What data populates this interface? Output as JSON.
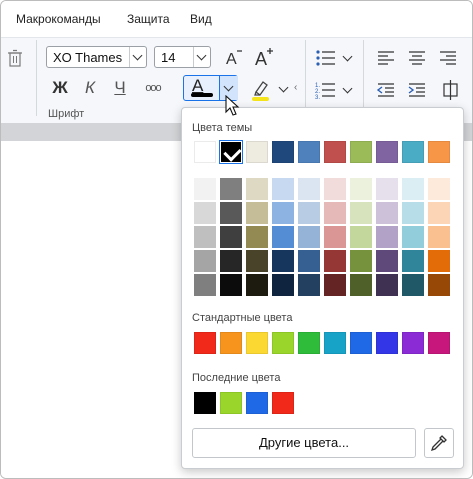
{
  "menubar": {
    "items": [
      "Макрокоманды",
      "Защита",
      "Вид"
    ]
  },
  "ribbon": {
    "font_name": "XO Thames",
    "font_size": "14",
    "font_group_label": "Шрифт",
    "bold_glyph": "Ж",
    "italic_glyph": "К",
    "underline_glyph": "Ч",
    "more_glyph": "ооо",
    "text_color_glyph": "А"
  },
  "color_panel": {
    "theme_title": "Цвета темы",
    "standard_title": "Стандартные цвета",
    "recent_title": "Последние цвета",
    "more_colors_label": "Другие цвета...",
    "selected_color": "#000000",
    "theme_colors": [
      "#ffffff",
      "#000000",
      "#eeece1",
      "#1f497d",
      "#4f81bd",
      "#c0504d",
      "#9bbb59",
      "#8064a2",
      "#4bacc6",
      "#f79646"
    ],
    "shade_columns": [
      [
        "#f2f2f2",
        "#d8d8d8",
        "#bfbfbf",
        "#a5a5a5",
        "#7f7f7f"
      ],
      [
        "#7f7f7f",
        "#595959",
        "#3f3f3f",
        "#262626",
        "#0c0c0c"
      ],
      [
        "#ddd9c3",
        "#c4bd97",
        "#938953",
        "#494429",
        "#1d1b10"
      ],
      [
        "#c6d9f0",
        "#8db3e2",
        "#548dd4",
        "#17365d",
        "#0f243e"
      ],
      [
        "#dbe5f1",
        "#b8cce4",
        "#95b3d7",
        "#366092",
        "#244061"
      ],
      [
        "#f2dcdb",
        "#e5b9b7",
        "#d99694",
        "#953734",
        "#632423"
      ],
      [
        "#ebf1dd",
        "#d7e3bc",
        "#c3d69b",
        "#76923c",
        "#4f6128"
      ],
      [
        "#e5e0ec",
        "#ccc1d9",
        "#b2a2c7",
        "#5f497a",
        "#3f3151"
      ],
      [
        "#dbeef3",
        "#b7dde8",
        "#92cddc",
        "#31859b",
        "#205867"
      ],
      [
        "#fdeada",
        "#fbd5b5",
        "#fac08f",
        "#e36c09",
        "#974806"
      ]
    ],
    "standard_colors": [
      "#f0291a",
      "#f7941d",
      "#fcd932",
      "#99d52a",
      "#2ebc3a",
      "#17a2c7",
      "#1f69e6",
      "#3236e6",
      "#8a2bd6",
      "#c7177c"
    ],
    "recent_colors": [
      "#000000",
      "#99d52a",
      "#1f69e6",
      "#f0291a"
    ]
  },
  "colors": {
    "accent": "#1a73e8",
    "ribbon_bg": "#f5f7fb",
    "highlight_yellow": "#f5e31c"
  },
  "icons": [
    "trash-icon",
    "grow-font-icon",
    "shrink-font-icon",
    "text-color-icon",
    "highlighter-icon",
    "bulleted-list-icon",
    "numbered-list-icon",
    "align-left-icon",
    "align-center-icon",
    "align-right-icon",
    "outdent-icon",
    "indent-icon",
    "line-spacing-icon",
    "eyedropper-icon",
    "mouse-cursor-icon"
  ]
}
